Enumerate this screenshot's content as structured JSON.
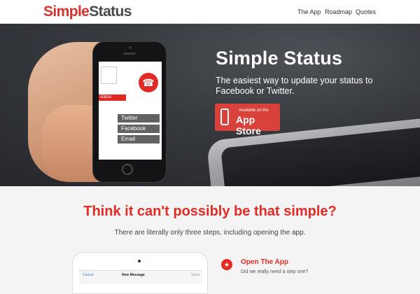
{
  "header": {
    "logo_part1": "Simple",
    "logo_part2": "Status",
    "nav": [
      {
        "label": "The App"
      },
      {
        "label": "Roadmap"
      },
      {
        "label": "Quotes"
      }
    ]
  },
  "hero": {
    "title": "Simple Status",
    "subtitle": "The easiest way to update your status to Facebook or Twitter.",
    "app_store": {
      "small": "Available on the",
      "big": "App Store"
    },
    "phone_screen": {
      "status_label": "status",
      "options": [
        "Twitter",
        "Facebook",
        "Email"
      ]
    }
  },
  "section": {
    "title": "Think it can't possibly be that simple?",
    "subtitle": "There are literally only three steps, including opening the app."
  },
  "tablet": {
    "cancel": "Cancel",
    "title": "New Message",
    "send": "Send"
  },
  "step": {
    "title": "Open The App",
    "description": "Did we really need a step one?"
  },
  "colors": {
    "brand_red": "#e22a25",
    "dark_gray": "#4a4a4a"
  },
  "icons": {
    "app_store_icon": "phone-icon",
    "trophy_icon": "trophy-icon",
    "phone_app_icon": "phone-handset-icon"
  }
}
